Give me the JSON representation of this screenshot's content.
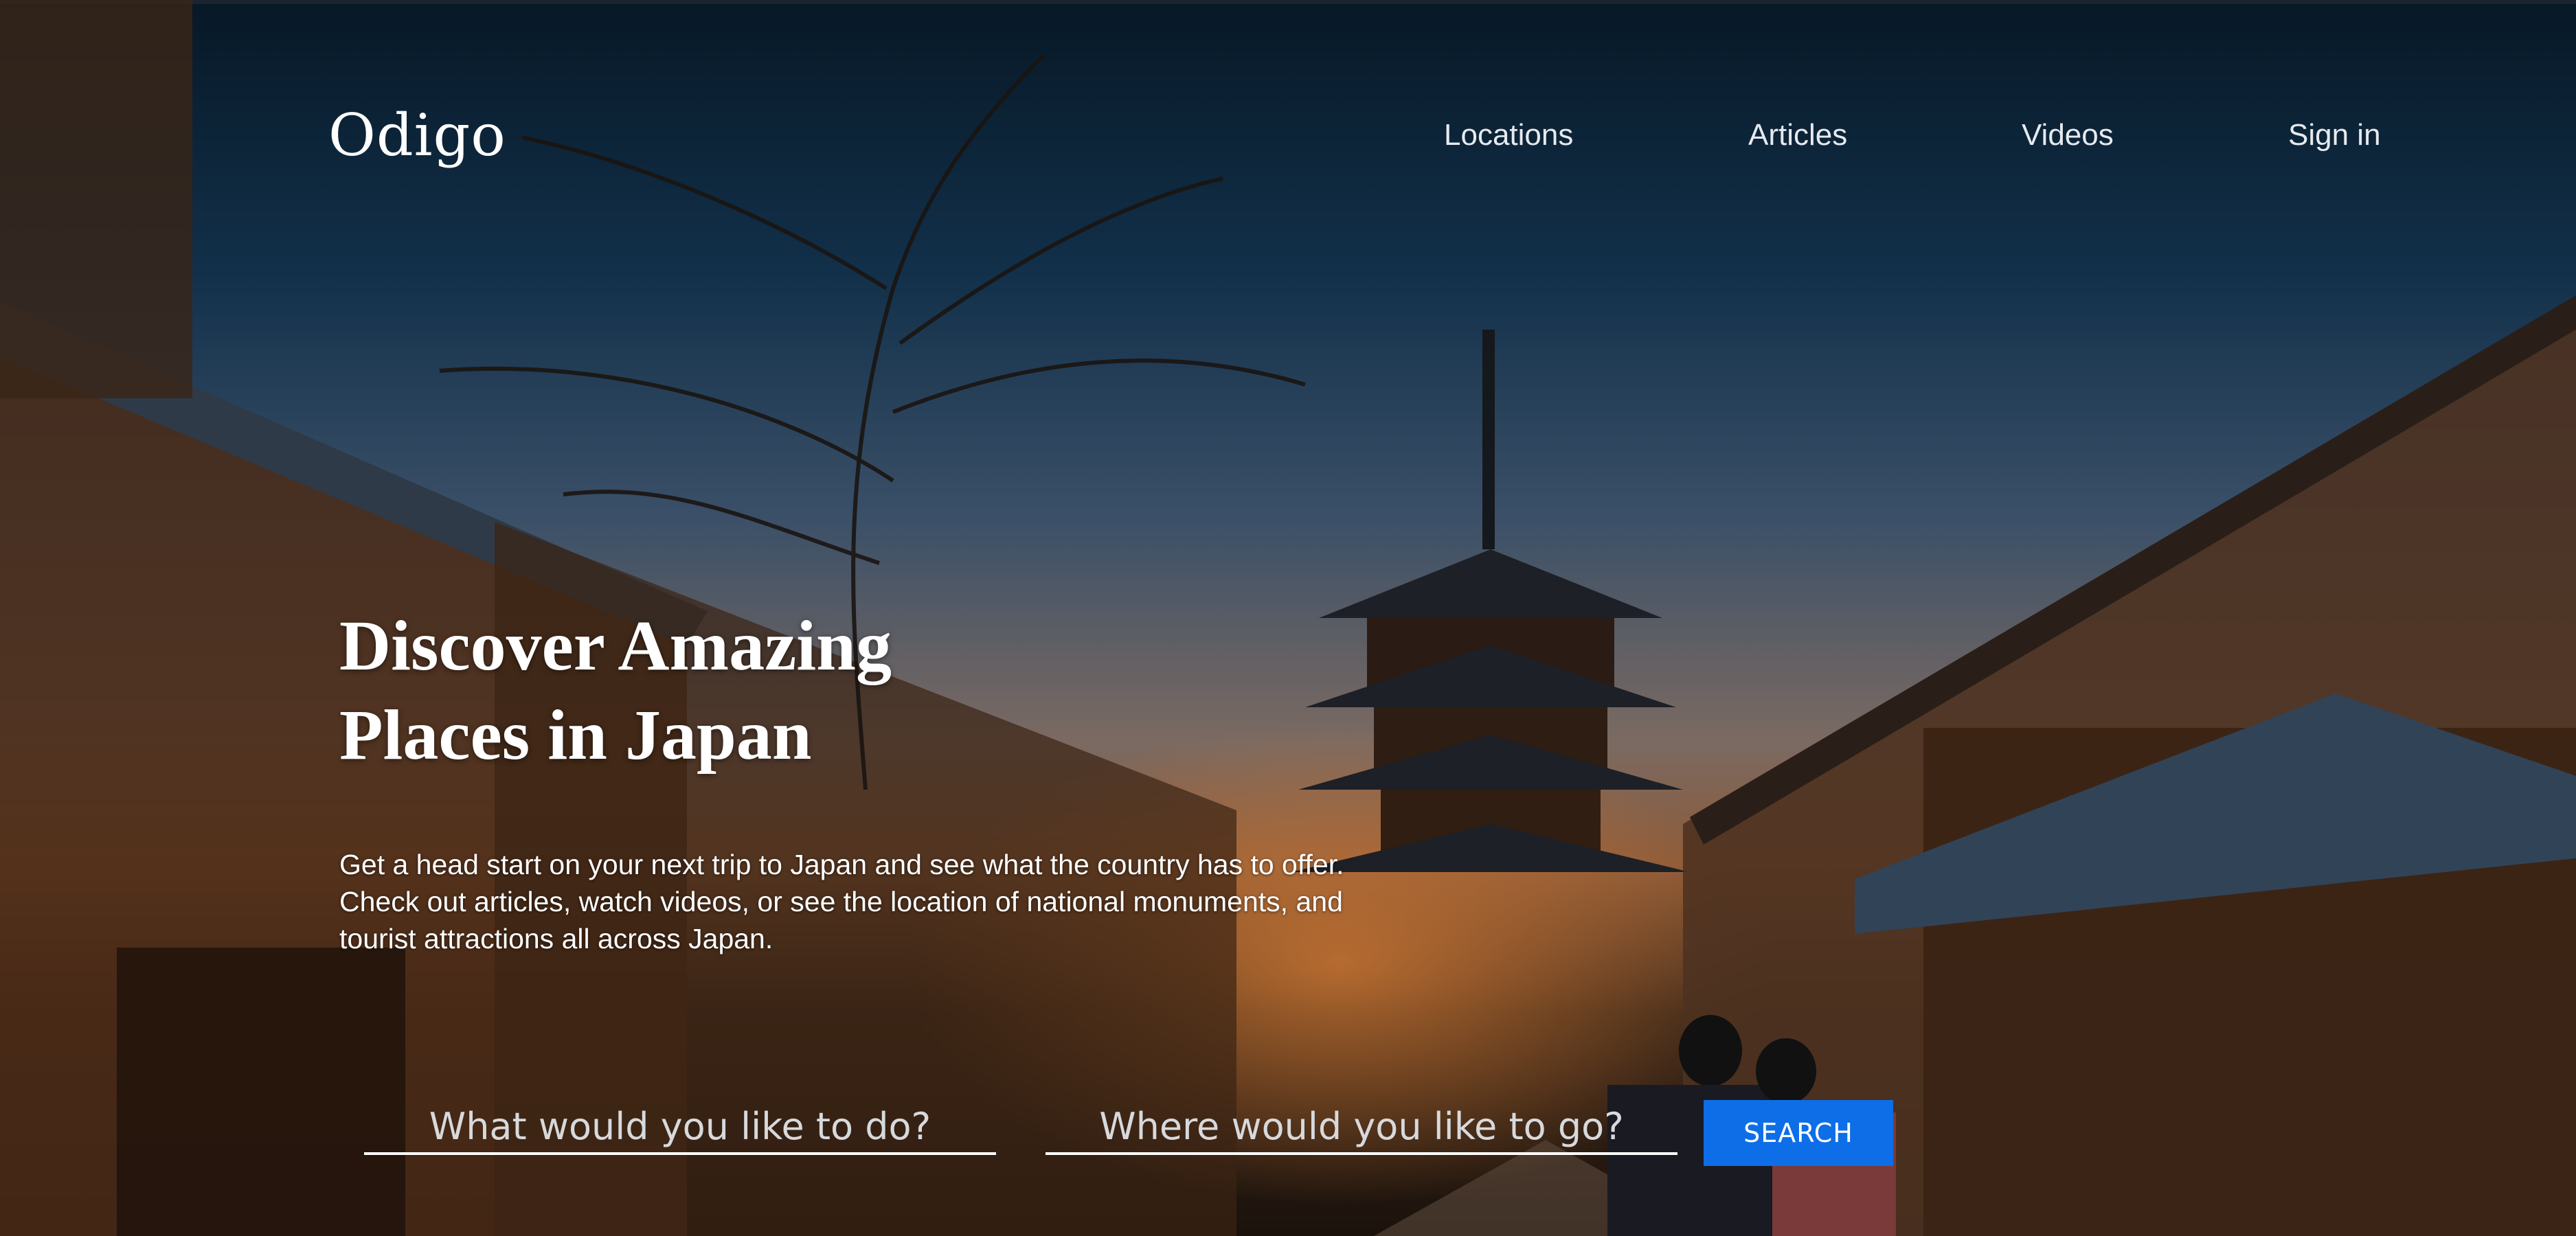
{
  "brand": {
    "logo_text": "Odigo"
  },
  "nav": {
    "items": [
      {
        "label": "Locations"
      },
      {
        "label": "Articles"
      },
      {
        "label": "Videos"
      },
      {
        "label": "Sign in"
      }
    ]
  },
  "hero": {
    "headline_line1": "Discover Amazing",
    "headline_line2": "Places in Japan",
    "subtext": "Get a head start on your next trip to Japan and see what the country has to offer. Check out articles, watch videos, or see the location of national monuments, and tourist attractions all across Japan."
  },
  "search": {
    "activity_placeholder": "What would you like to do?",
    "activity_value": "",
    "location_placeholder": "Where would you like to go?",
    "location_value": "",
    "button_label": "SEARCH"
  },
  "colors": {
    "button": "#0d6ee8",
    "text": "#ffffff",
    "nav_text": "#e6e9ee"
  }
}
